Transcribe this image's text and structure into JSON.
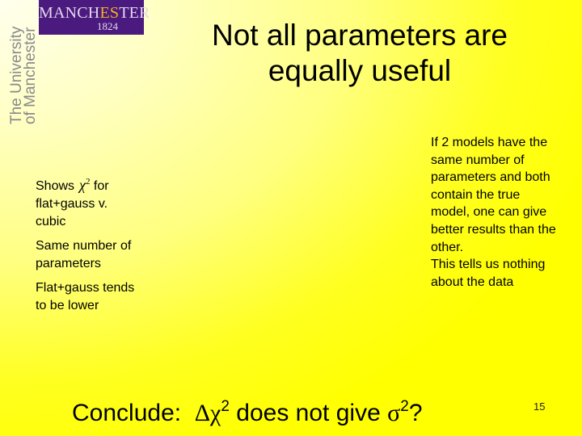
{
  "logo": {
    "word_prefix": "MANCH",
    "word_highlight": "ES",
    "word_suffix": "TER",
    "year": "1824",
    "vertical_line1": "The University",
    "vertical_line2": "of Manchester"
  },
  "slide": {
    "title_line1": "Not all parameters are",
    "title_line2": "equally useful",
    "left_paragraphs": {
      "p1_prefix": "Shows",
      "p1_symbol": "χ",
      "p1_sup": "2",
      "p1_rest": "for flat+gauss v. cubic",
      "p2": "Same number of parameters",
      "p3": "Flat+gauss tends to be lower"
    },
    "right_paragraphs": [
      "If 2 models have the same number of parameters and both contain the true model, one can give better results than the other.",
      "This tells us nothing about the data"
    ],
    "conclusion": {
      "label": "Conclude:",
      "delta_chi": "Δχ",
      "sup1": "2",
      "middle": " does not give ",
      "sigma": "σ",
      "sup2": "2",
      "end": "?"
    },
    "page_number": "15"
  },
  "colors": {
    "logo_bg": "#4b1a7e",
    "logo_highlight": "#f2b31e",
    "background_main": "#ffff00"
  }
}
